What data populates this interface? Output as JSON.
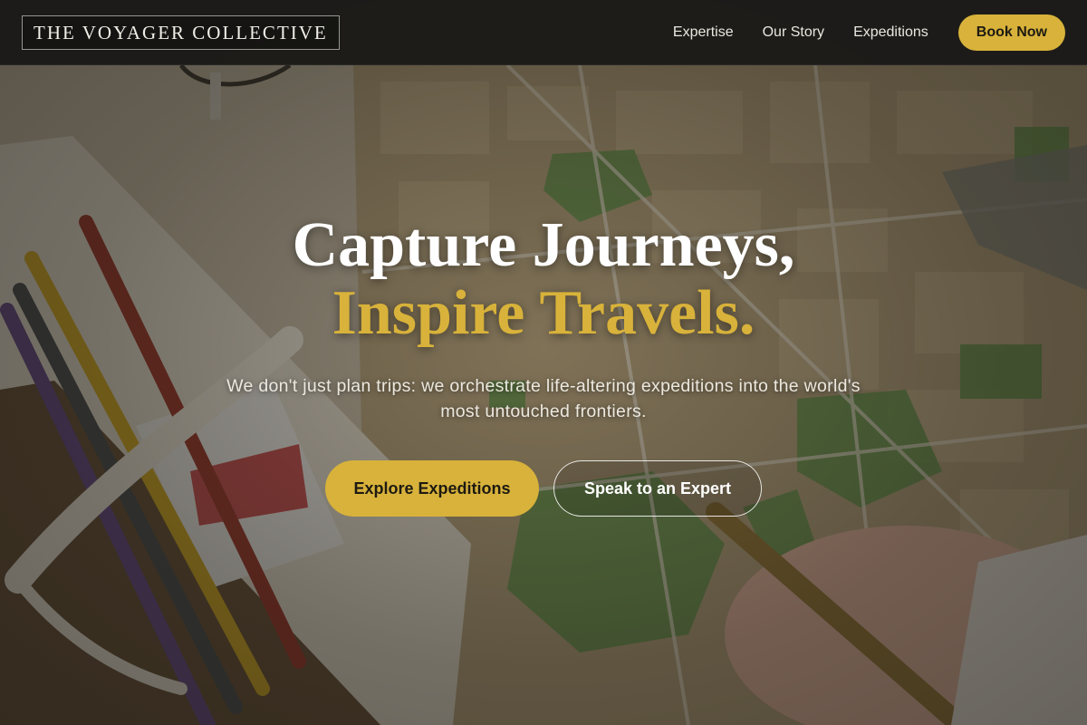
{
  "nav": {
    "logo": "THE VOYAGER COLLECTIVE",
    "links": [
      "Expertise",
      "Our Story",
      "Expeditions"
    ],
    "cta": "Book Now"
  },
  "hero": {
    "headline_line1": "Capture Journeys,",
    "headline_line2": "Inspire Travels.",
    "subtitle": "We don't just plan trips: we orchestrate life-altering expeditions into the world's most untouched frontiers.",
    "primary_cta": "Explore Expeditions",
    "secondary_cta": "Speak to an Expert",
    "background_image": "travel-map-desk-photo"
  },
  "colors": {
    "accent": "#d8b23a",
    "nav_bg": "#1a1917",
    "text_light": "#ffffff"
  }
}
